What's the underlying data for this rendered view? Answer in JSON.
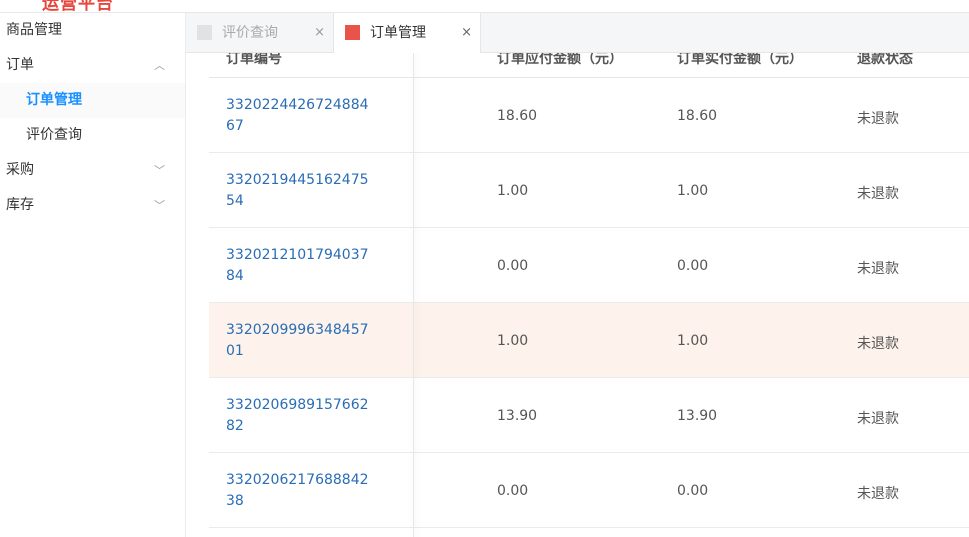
{
  "header": {
    "brand": "运营平台",
    "brand_icon": "grid-icon"
  },
  "sidebar": {
    "items": [
      {
        "label": "商品管理",
        "level": 1
      },
      {
        "label": "订单",
        "level": 1,
        "expanded": true,
        "icon": "chevron-up-icon"
      },
      {
        "label": "订单管理",
        "level": 2,
        "active": true
      },
      {
        "label": "评价查询",
        "level": 2
      },
      {
        "label": "采购",
        "level": 1,
        "icon": "chevron-down-icon"
      },
      {
        "label": "库存",
        "level": 1,
        "icon": "chevron-down-icon"
      }
    ]
  },
  "tabs": [
    {
      "label": "评价查询",
      "active": false,
      "close": "×"
    },
    {
      "label": "订单管理",
      "active": true,
      "close": "×"
    }
  ],
  "table": {
    "columns": [
      "订单编号",
      "订单应付金额（元）",
      "订单实付金额（元）",
      "退款状态"
    ],
    "rows": [
      {
        "order_id": "332022442672488467",
        "payable": "18.60",
        "paid": "18.60",
        "refund": "未退款"
      },
      {
        "order_id": "332021944516247554",
        "payable": "1.00",
        "paid": "1.00",
        "refund": "未退款"
      },
      {
        "order_id": "332021210179403784",
        "payable": "0.00",
        "paid": "0.00",
        "refund": "未退款"
      },
      {
        "order_id": "332020999634845701",
        "payable": "1.00",
        "paid": "1.00",
        "refund": "未退款"
      },
      {
        "order_id": "332020698915766282",
        "payable": "13.90",
        "paid": "13.90",
        "refund": "未退款"
      },
      {
        "order_id": "332020621768884238",
        "payable": "0.00",
        "paid": "0.00",
        "refund": "未退款"
      }
    ],
    "highlighted_row": 3
  },
  "colors": {
    "accent": "#1890ff",
    "brand": "#e8453c",
    "link": "#2a6db5",
    "row_highlight": "#fdf3ec"
  }
}
